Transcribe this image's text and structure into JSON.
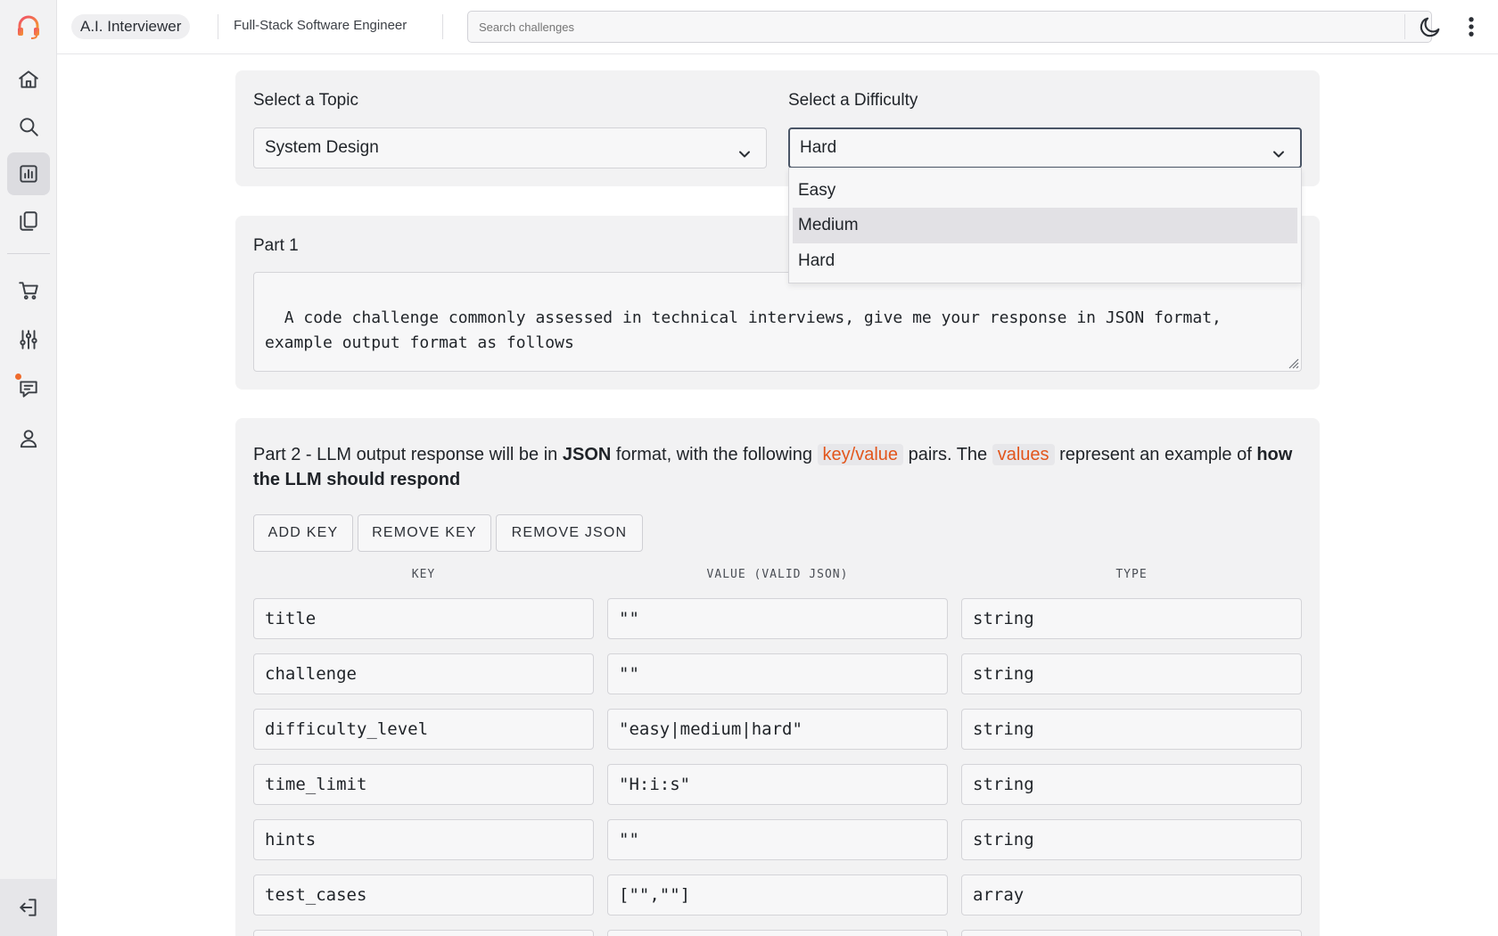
{
  "topbar": {
    "app_name": "A.I. Interviewer",
    "role": "Full-Stack Software Engineer",
    "search_placeholder": "Search challenges"
  },
  "sidebar": {
    "items": [
      {
        "icon": "home-icon"
      },
      {
        "icon": "search-icon"
      },
      {
        "icon": "chart-icon",
        "active": true
      },
      {
        "icon": "copy-icon"
      },
      {
        "icon": "cart-icon"
      },
      {
        "icon": "sliders-icon"
      },
      {
        "icon": "chat-icon",
        "badge": true
      },
      {
        "icon": "user-icon"
      }
    ],
    "bottom_icon": "logout-icon"
  },
  "selectors": {
    "topic_label": "Select a Topic",
    "topic_value": "System Design",
    "difficulty_label": "Select a Difficulty",
    "difficulty_value": "Hard",
    "difficulty_options": [
      "Easy",
      "Medium",
      "Hard"
    ]
  },
  "part1": {
    "label": "Part 1",
    "text": "A code challenge commonly assessed in technical interviews, give me your response in JSON format,\nexample output format as follows"
  },
  "part2": {
    "t1": "Part 2 - LLM output response will be in ",
    "t2": "JSON",
    "t3": " format, with the following ",
    "t4": "key/value",
    "t5": " pairs. The ",
    "t6": "values",
    "t7": " represent an example of ",
    "t8": "how the LLM should respond",
    "buttons": [
      "ADD KEY",
      "REMOVE KEY",
      "REMOVE JSON"
    ],
    "columns": [
      "KEY",
      "VALUE (VALID JSON)",
      "TYPE"
    ],
    "rows": [
      {
        "key": "title",
        "value": "\"\"",
        "type": "string"
      },
      {
        "key": "challenge",
        "value": "\"\"",
        "type": "string"
      },
      {
        "key": "difficulty_level",
        "value": "\"easy|medium|hard\"",
        "type": "string"
      },
      {
        "key": "time_limit",
        "value": "\"H:i:s\"",
        "type": "string"
      },
      {
        "key": "hints",
        "value": "\"\"",
        "type": "string"
      },
      {
        "key": "test_cases",
        "value": "[\"\",\"\"]",
        "type": "array"
      }
    ]
  },
  "colors": {
    "accent": "#e2561c",
    "badge": "#ef6b2c"
  }
}
